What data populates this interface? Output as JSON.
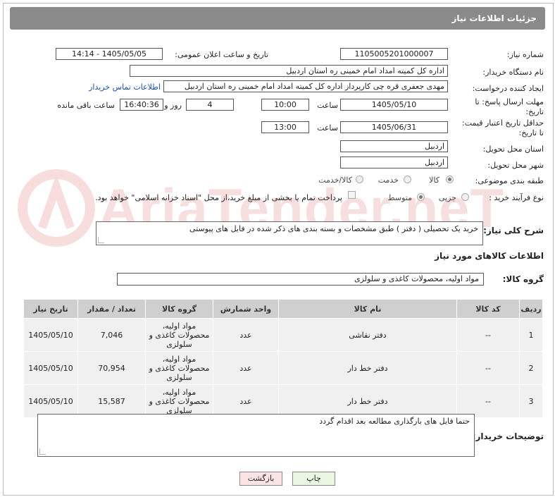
{
  "header": {
    "title": "جزئیات اطلاعات نیاز"
  },
  "fields": {
    "need_number_label": "شماره نیاز:",
    "need_number": "1105005201000007",
    "announce_label": "تاریخ و ساعت اعلان عمومی:",
    "announce_value": "1405/05/05 - 14:14",
    "buyer_org_label": "نام دستگاه خریدار:",
    "buyer_org": "اداره کل کمیته امداد امام خمینی  ره  استان اردبیل",
    "creator_label": "ایجاد کننده درخواست:",
    "creator": "مهدی جعفری قره چی کارپرداز اداره کل کمیته امداد امام خمینی  ره  استان اردبیل",
    "contact_link": "اطلاعات تماس خریدار",
    "deadline_label_1": "مهلت ارسال پاسخ: تا",
    "deadline_label_2": "تاریخ:",
    "deadline_date": "1405/05/10",
    "time_label": "ساعت",
    "deadline_time": "10:00",
    "days": "4",
    "days_label": "روز و",
    "remaining_time": "16:40:36",
    "remaining_label": "ساعت باقی مانده",
    "min_validity_label_1": "حداقل تاریخ اعتبار قیمت:",
    "min_validity_label_2": "تا تاریخ:",
    "validity_date": "1405/06/31",
    "validity_time": "13:00",
    "province_label": "استان محل تحویل:",
    "province": "اردبیل",
    "city_label": "شهر محل تحویل:",
    "city": "اردبیل",
    "category_label": "طبقه بندی موضوعی:",
    "category_options": [
      "کالا",
      "خدمت",
      "کالا/خدمت"
    ],
    "process_label": "نوع فرآیند خرید :",
    "process_options": [
      "جزیی",
      "متوسط"
    ],
    "payment_note": "پرداخت تمام یا بخشی از مبلغ خرید،از محل \"اسناد خزانه اسلامی\" خواهد بود."
  },
  "description": {
    "label": "شرح کلی نیاز:",
    "text": "خرید یک تحصیلی ( دفتر ) طبق مشخصات و بسته بندی های ذکر شده در فایل های پیوستی"
  },
  "goods": {
    "section_title": "اطلاعات کالاهای مورد نیاز",
    "group_label": "گروه کالا:",
    "group_value": "مواد اولیه، محصولات کاغذی و سلولزی",
    "columns": [
      "ردیف",
      "کد کالا",
      "نام کالا",
      "واحد شمارش",
      "گروه کالا",
      "تعداد / مقدار",
      "تاریخ نیاز"
    ],
    "rows": [
      {
        "row": "1",
        "code": "--",
        "name": "دفتر نقاشی",
        "unit": "عدد",
        "group": "مواد اولیه، محصولات کاغذی و سلولزی",
        "qty": "7,046",
        "date": "1405/05/10"
      },
      {
        "row": "2",
        "code": "--",
        "name": "دفتر خط دار",
        "unit": "عدد",
        "group": "مواد اولیه، محصولات کاغذی و سلولزی",
        "qty": "70,954",
        "date": "1405/05/10"
      },
      {
        "row": "3",
        "code": "--",
        "name": "دفتر خط دار",
        "unit": "عدد",
        "group": "مواد اولیه، محصولات کاغذی و سلولزی",
        "qty": "15,587",
        "date": "1405/05/10"
      }
    ]
  },
  "buyer_notes": {
    "label": "توضیحات خریدار:",
    "text": "حتما فایل های بارگذاری مطالعه بعد اقدام گردد"
  },
  "buttons": {
    "print": "چاپ",
    "back": "بازگشت"
  },
  "watermark": {
    "text": "AriaTender.neT"
  },
  "colors": {
    "header_bg": "#8a8a8a",
    "link": "#1a4fb4",
    "back_button_bg": "#fde4e4",
    "print_button_bg": "#e9f7e3",
    "table_header_bg": "#cfcfcf"
  }
}
